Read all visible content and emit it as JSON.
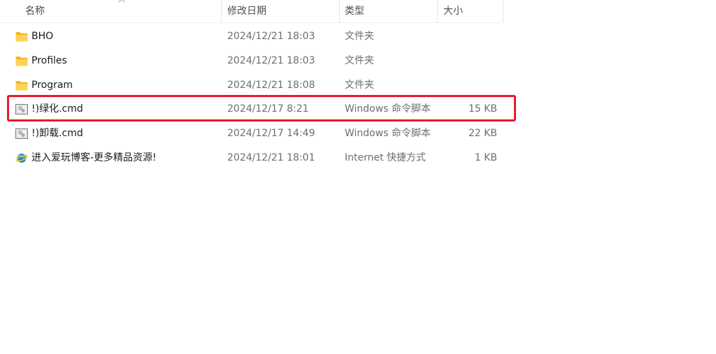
{
  "columns": {
    "name": "名称",
    "modified": "修改日期",
    "type": "类型",
    "size": "大小"
  },
  "files": [
    {
      "name": "BHO",
      "modified": "2024/12/21 18:03",
      "type": "文件夹",
      "size": "",
      "icon": "folder-icon"
    },
    {
      "name": "Profiles",
      "modified": "2024/12/21 18:03",
      "type": "文件夹",
      "size": "",
      "icon": "folder-icon"
    },
    {
      "name": "Program",
      "modified": "2024/12/21 18:08",
      "type": "文件夹",
      "size": "",
      "icon": "folder-icon"
    },
    {
      "name": "!)绿化.cmd",
      "modified": "2024/12/17 8:21",
      "type": "Windows 命令脚本",
      "size": "15 KB",
      "icon": "cmd-script-icon"
    },
    {
      "name": "!)卸载.cmd",
      "modified": "2024/12/17 14:49",
      "type": "Windows 命令脚本",
      "size": "22 KB",
      "icon": "cmd-script-icon"
    },
    {
      "name": "进入爱玩博客-更多精品资源!",
      "modified": "2024/12/21 18:01",
      "type": "Internet 快捷方式",
      "size": "1 KB",
      "icon": "internet-shortcut-icon"
    }
  ],
  "colors": {
    "highlight": "#e8192c",
    "folder": "#f8c840"
  }
}
